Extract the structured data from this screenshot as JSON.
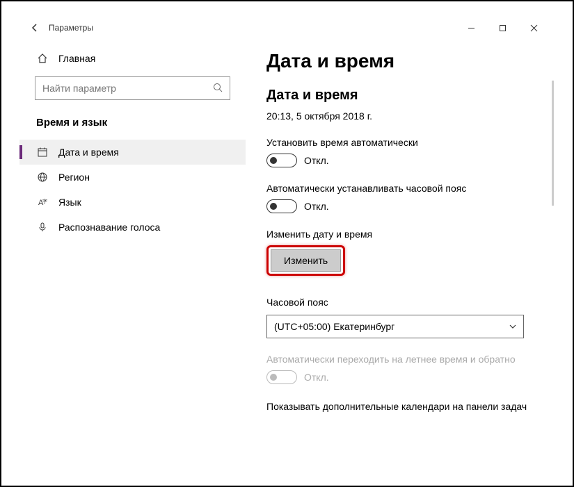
{
  "titlebar": {
    "app_title": "Параметры"
  },
  "sidebar": {
    "home_label": "Главная",
    "search_placeholder": "Найти параметр",
    "section_title": "Время и язык",
    "items": [
      {
        "label": "Дата и время"
      },
      {
        "label": "Регион"
      },
      {
        "label": "Язык"
      },
      {
        "label": "Распознавание голоса"
      }
    ]
  },
  "main": {
    "page_title": "Дата и время",
    "section_title": "Дата и время",
    "current_datetime": "20:13, 5 октября 2018 г.",
    "auto_time_label": "Установить время автоматически",
    "auto_time_state": "Откл.",
    "auto_tz_label": "Автоматически устанавливать часовой пояс",
    "auto_tz_state": "Откл.",
    "change_dt_label": "Изменить дату и время",
    "change_button": "Изменить",
    "tz_label": "Часовой пояс",
    "tz_value": "(UTC+05:00) Екатеринбург",
    "dst_label": "Автоматически переходить на летнее время и обратно",
    "dst_state": "Откл.",
    "extra_cal_label": "Показывать дополнительные календари на панели задач"
  }
}
